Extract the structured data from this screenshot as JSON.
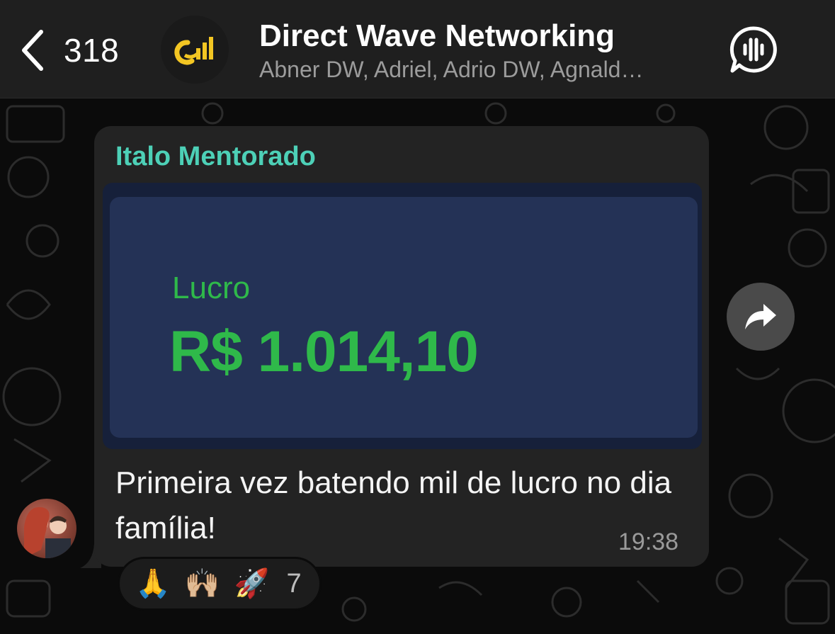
{
  "header": {
    "back_count": "318",
    "group_name": "Direct Wave Networking",
    "group_members": "Abner DW, Adriel, Adrio DW, Agnald…",
    "avatar_icon": "direct-wave-logo",
    "call_icon": "group-voice-call-icon"
  },
  "message": {
    "sender": "Italo Mentorado",
    "media": {
      "label": "Lucro",
      "value": "R$ 1.014,10"
    },
    "text": "Primeira vez batendo mil de lucro no dia família!",
    "time": "19:38"
  },
  "reactions": {
    "emojis": [
      "🙏",
      "🙌🏼",
      "🚀"
    ],
    "count": "7"
  },
  "colors": {
    "sender_name": "#4dd0b7",
    "profit_green": "#2fb94a",
    "bubble": "#232323",
    "header": "#1f1f1f"
  }
}
